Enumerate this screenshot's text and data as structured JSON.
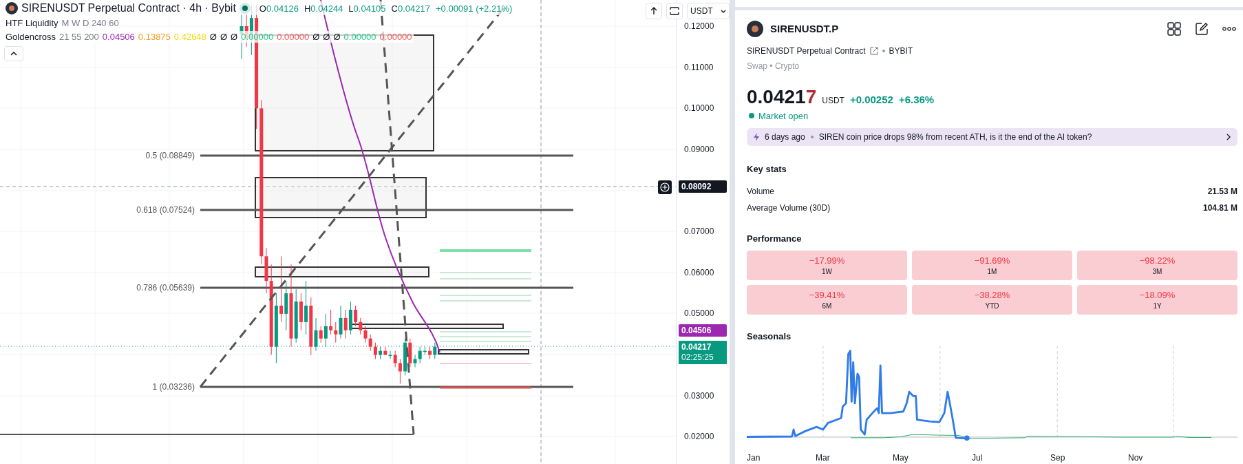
{
  "chart": {
    "title": "SIRENUSDT Perpetual Contract · 4h · Bybit",
    "ohlc": [
      {
        "label": "O",
        "value": "0.04126"
      },
      {
        "label": "H",
        "value": "0.04244"
      },
      {
        "label": "L",
        "value": "0.04105"
      },
      {
        "label": "C",
        "value": "0.04217"
      }
    ],
    "change": "+0.00091 (+2.21%)",
    "indicators": [
      {
        "name": "HTF Liquidity",
        "params": "M W D 240 60"
      },
      {
        "name": "Goldencross",
        "params": "21 55 200",
        "values": [
          {
            "text": "0.04506",
            "color": "#9c27b0"
          },
          {
            "text": "0.13875",
            "color": "#f59c1a"
          },
          {
            "text": "0.42648",
            "color": "#f5d90a"
          },
          {
            "text": "Ø",
            "color": "#131722"
          },
          {
            "text": "Ø",
            "color": "#131722"
          },
          {
            "text": "Ø",
            "color": "#131722"
          },
          {
            "text": "0.00000",
            "color": "#22c98a"
          },
          {
            "text": "0.00000",
            "color": "#f05454"
          },
          {
            "text": "Ø",
            "color": "#131722"
          },
          {
            "text": "Ø",
            "color": "#131722"
          },
          {
            "text": "Ø",
            "color": "#131722"
          },
          {
            "text": "0.00000",
            "color": "#22c98a"
          },
          {
            "text": "0.00000",
            "color": "#f05454"
          }
        ]
      }
    ],
    "currency": "USDT",
    "fib_levels": [
      "0.5 (0.08849)",
      "0.618 (0.07524)",
      "0.786 (0.05639)",
      "1 (0.03236)"
    ],
    "price_axis": [
      "0.12000",
      "0.11000",
      "0.10000",
      "0.09000",
      "0.07000",
      "0.06000",
      "0.05000",
      "0.03000",
      "0.02000"
    ],
    "crosshair_price": "0.08092",
    "ma_price": "0.04506",
    "last_price": "0.04217",
    "countdown": "02:25:25"
  },
  "panel": {
    "symbol": "SIRENUSDT.P",
    "contract": "SIRENUSDT Perpetual Contract",
    "exchange": "BYBIT",
    "category": "Swap • Crypto",
    "price": "0.0421",
    "price_last_digit": "7",
    "currency": "USDT",
    "change": "+0.00252",
    "change_percent": "+6.36%",
    "market_status": "Market open",
    "news": {
      "age": "6 days ago",
      "headline": "SIREN coin price drops 98% from recent ATH, is it the end of the AI token?"
    },
    "key_stats": {
      "title": "Key stats",
      "rows": [
        {
          "label": "Volume",
          "value": "21.53 M"
        },
        {
          "label": "Average Volume (30D)",
          "value": "104.81 M"
        }
      ]
    },
    "performance": {
      "title": "Performance",
      "tiles": [
        {
          "value": "−17.99%",
          "period": "1W"
        },
        {
          "value": "−91.69%",
          "period": "1M"
        },
        {
          "value": "−98.22%",
          "period": "3M"
        },
        {
          "value": "−39.41%",
          "period": "6M"
        },
        {
          "value": "−38.28%",
          "period": "YTD"
        },
        {
          "value": "−18.09%",
          "period": "1Y"
        }
      ]
    },
    "seasonals": {
      "title": "Seasonals",
      "months": [
        "Jan",
        "Mar",
        "May",
        "Jul",
        "Sep",
        "Nov"
      ]
    }
  }
}
